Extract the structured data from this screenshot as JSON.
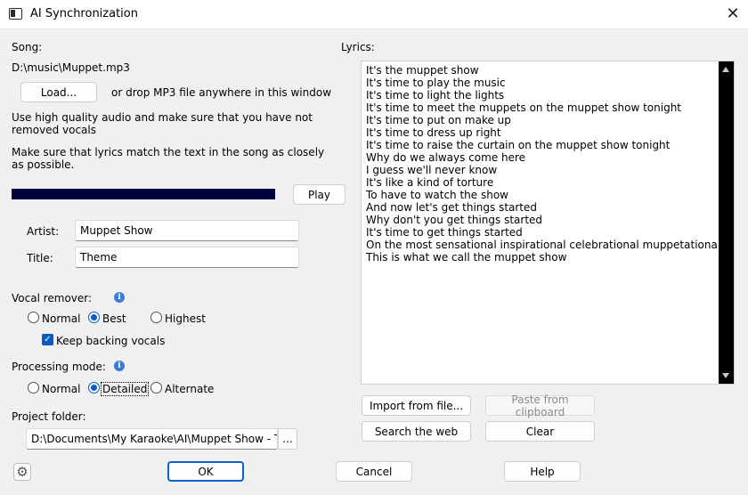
{
  "window": {
    "title": "AI Synchronization"
  },
  "song": {
    "label": "Song:",
    "path": "D:\\music\\Muppet.mp3",
    "load_label": "Load...",
    "drop_hint": "or drop MP3 file anywhere in this window",
    "hint1_line1": "Use high quality audio and make sure that you have not",
    "hint1_line2": "removed vocals",
    "hint2_line1": "Make sure that lyrics match the text in the song as closely",
    "hint2_line2": "as possible.",
    "play_label": "Play"
  },
  "artist": {
    "label": "Artist:",
    "value": "Muppet Show"
  },
  "title": {
    "label": "Title:",
    "value": "Theme"
  },
  "vocal_remover": {
    "label": "Vocal remover:",
    "options": [
      "Normal",
      "Best",
      "Highest"
    ],
    "selected": "Best",
    "keep_backing": "Keep backing vocals"
  },
  "processing": {
    "label": "Processing mode:",
    "options": [
      "Normal",
      "Detailed",
      "Alternate"
    ],
    "selected": "Detailed"
  },
  "project": {
    "label": "Project folder:",
    "value": "D:\\Documents\\My Karaoke\\AI\\Muppet Show - T",
    "browse": "..."
  },
  "lyrics": {
    "label": "Lyrics:",
    "text": "It's the muppet show\nIt's time to play the music\nIt's time to light the lights\nIt's time to meet the muppets on the muppet show tonight\nIt's time to put on make up\nIt's time to dress up right\nIt's time to raise the curtain on the muppet show tonight\nWhy do we always come here\nI guess we'll never know\nIt's like a kind of torture\nTo have to watch the show\nAnd now let's get things started\nWhy don't you get things started\nIt's time to get things started\nOn the most sensational inspirational celebrational muppetational\nThis is what we call the muppet show",
    "import_label": "Import from file...",
    "paste_label": "Paste from clipboard",
    "search_label": "Search the web",
    "clear_label": "Clear"
  },
  "footer": {
    "ok": "OK",
    "cancel": "Cancel",
    "help": "Help"
  }
}
